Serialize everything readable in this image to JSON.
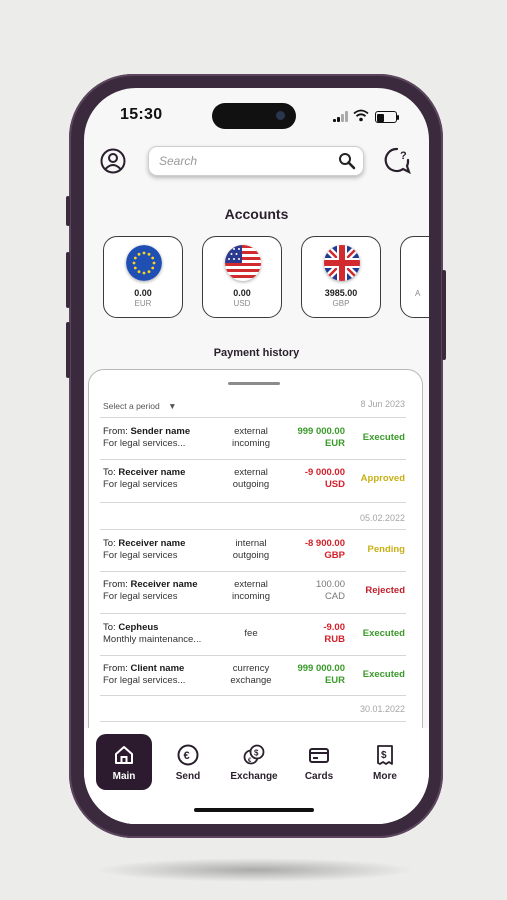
{
  "status_bar": {
    "time": "15:30"
  },
  "search": {
    "placeholder": "Search"
  },
  "accounts": {
    "title": "Accounts",
    "items": [
      {
        "amount": "0.00",
        "currency": "EUR",
        "flag": "eu-flag-icon"
      },
      {
        "amount": "0.00",
        "currency": "USD",
        "flag": "us-flag-icon"
      },
      {
        "amount": "3985.00",
        "currency": "GBP",
        "flag": "uk-flag-icon"
      },
      {
        "amount": "",
        "currency": "A",
        "flag": "add-account-icon"
      }
    ]
  },
  "history": {
    "title": "Payment history",
    "period_label": "Select a period",
    "groups": [
      {
        "date": "8 Jun 2023",
        "rows": [
          {
            "prefix": "From:",
            "name": "Sender name",
            "desc": "For legal services...",
            "type1": "external",
            "type2": "incoming",
            "amount": "999 000.00",
            "currency": "EUR",
            "status": "Executed"
          },
          {
            "prefix": "To:",
            "name": "Receiver name",
            "desc": "For legal services",
            "type1": "external",
            "type2": "outgoing",
            "amount": "-9 000.00",
            "currency": "USD",
            "status": "Approved"
          }
        ]
      },
      {
        "date": "05.02.2022",
        "rows": [
          {
            "prefix": "To:",
            "name": "Receiver name",
            "desc": "For legal services",
            "type1": "internal",
            "type2": "outgoing",
            "amount": "-8 900.00",
            "currency": "GBP",
            "status": "Pending"
          },
          {
            "prefix": "From:",
            "name": "Receiver name",
            "desc": "For legal services",
            "type1": "external",
            "type2": "incoming",
            "amount": "100.00",
            "currency": "CAD",
            "status": "Rejected"
          },
          {
            "prefix": "To:",
            "name": "Cepheus",
            "desc": "Monthly maintenance...",
            "type1": "fee",
            "type2": "",
            "amount": "-9.00",
            "currency": "RUB",
            "status": "Executed"
          },
          {
            "prefix": "From:",
            "name": "Client name",
            "desc": "For legal services...",
            "type1": "currency",
            "type2": "exchange",
            "amount": "999 000.00",
            "currency": "EUR",
            "status": "Executed"
          }
        ]
      },
      {
        "date": "30.01.2022",
        "rows": []
      }
    ]
  },
  "tabs": [
    {
      "label": "Main",
      "icon": "home-icon",
      "active": true
    },
    {
      "label": "Send",
      "icon": "euro-coin-icon",
      "active": false
    },
    {
      "label": "Exchange",
      "icon": "exchange-coins-icon",
      "active": false
    },
    {
      "label": "Cards",
      "icon": "card-icon",
      "active": false
    },
    {
      "label": "More",
      "icon": "receipt-icon",
      "active": false
    }
  ],
  "colors": {
    "accent": "#2c1a2e",
    "executed": "#3a9a2a",
    "negative": "#d3202a",
    "pending": "#c8b015"
  }
}
